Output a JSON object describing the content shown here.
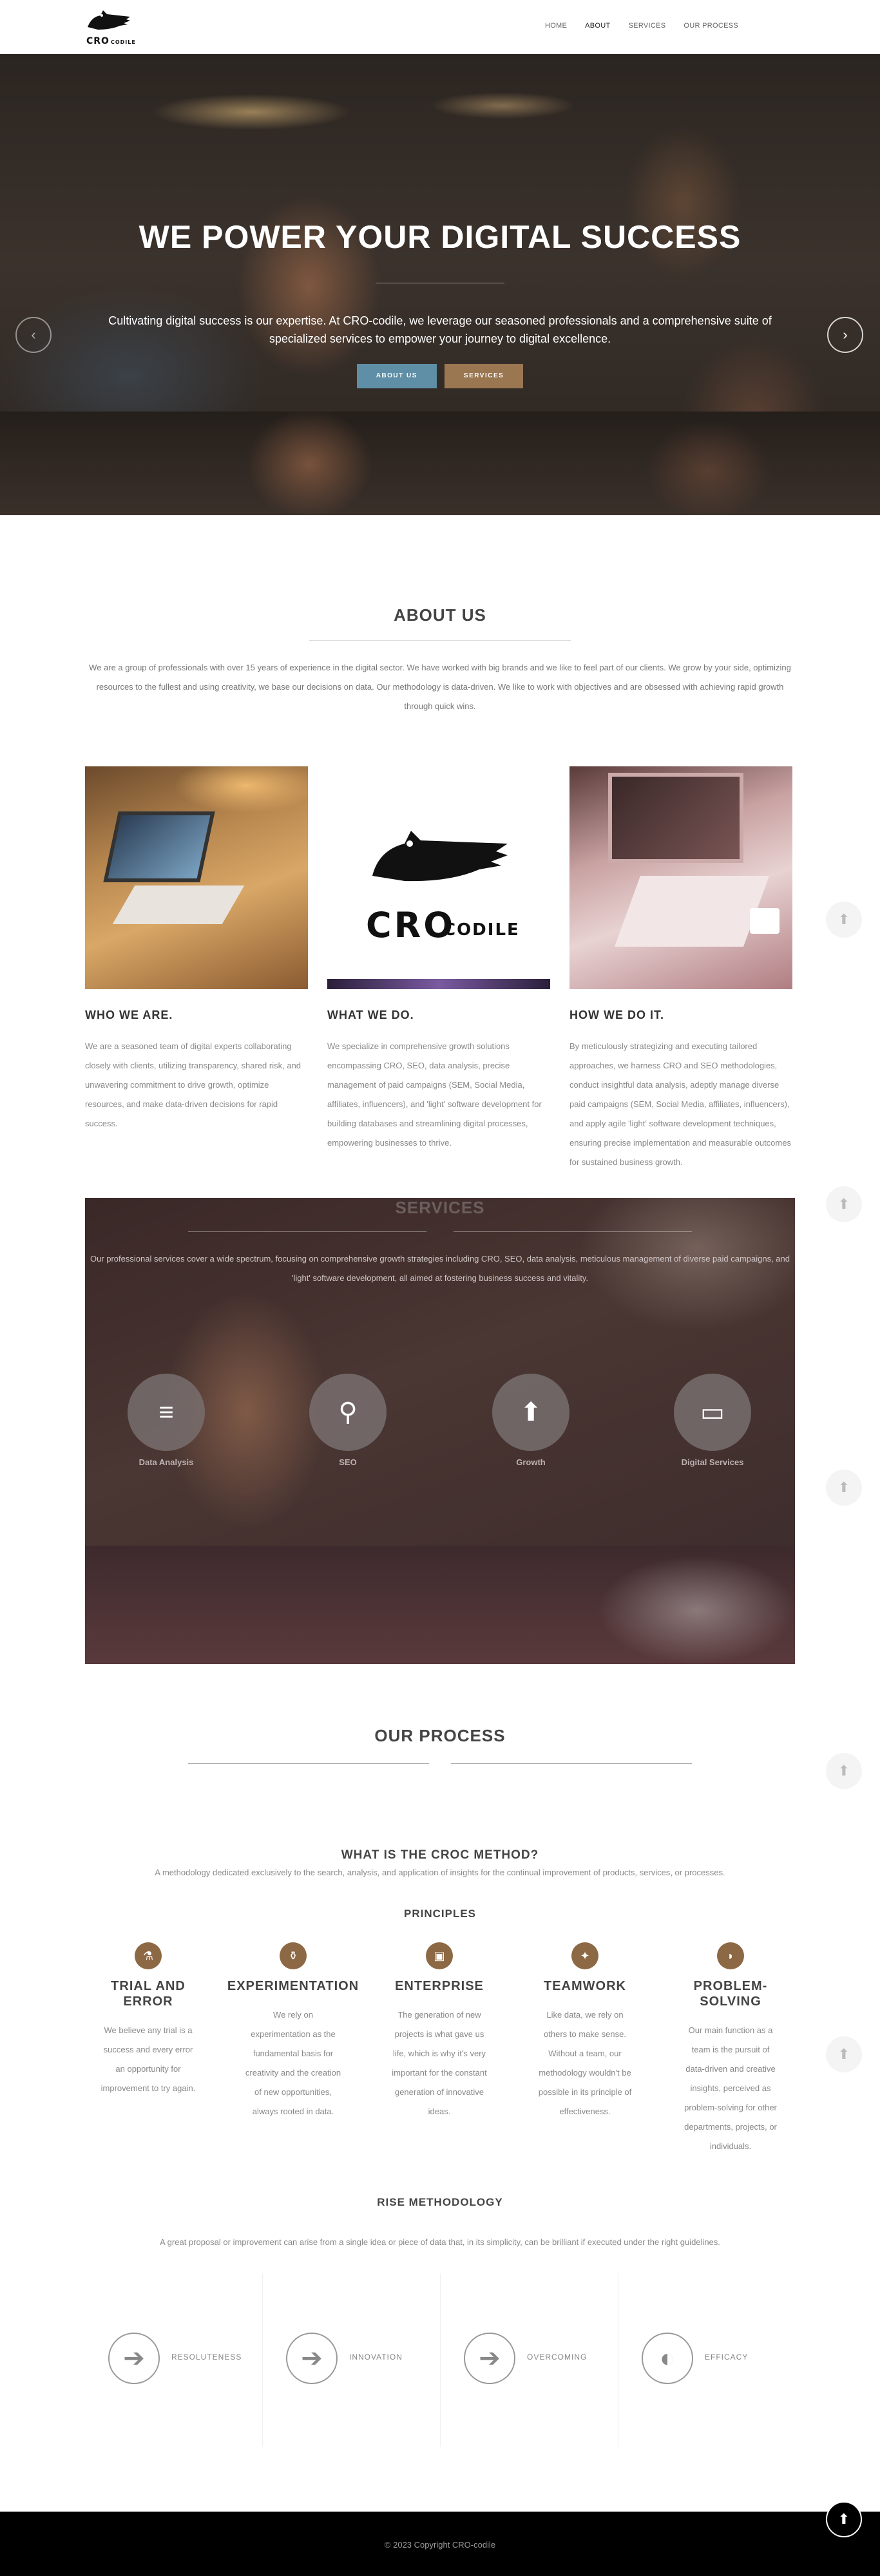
{
  "brand": {
    "name": "CRO",
    "suffix": "CODILE"
  },
  "nav": {
    "items": [
      "HOME",
      "ABOUT",
      "SERVICES",
      "OUR PROCESS"
    ],
    "active": "ABOUT"
  },
  "hero": {
    "title": "WE POWER YOUR DIGITAL SUCCESS",
    "text": "Cultivating digital success is our expertise. At CRO-codile, we leverage our seasoned professionals and a comprehensive suite of specialized services to empower your journey to digital excellence.",
    "buttons": [
      "ABOUT US",
      "SERVICES"
    ],
    "prev_icon": "chevron-left-icon",
    "next_icon": "chevron-right-icon"
  },
  "about": {
    "title": "ABOUT US",
    "text": "We are a group of professionals with over 15 years of experience in the digital sector. We have worked with big brands and we like to feel part of our clients. We grow by your side, optimizing resources to the fullest and using creativity, we base our decisions on data. Our methodology is data-driven. We like to work with objectives and are obsessed with achieving rapid growth through quick wins.",
    "cards": [
      {
        "title": "WHO WE ARE.",
        "text": "We are a seasoned team of digital experts collaborating closely with clients, utilizing transparency, shared risk, and unwavering commitment to drive growth, optimize resources, and make data-driven decisions for rapid success."
      },
      {
        "title": "WHAT WE DO.",
        "text": "We specialize in comprehensive growth solutions encompassing CRO, SEO, data analysis, precise management of paid campaigns (SEM, Social Media, affiliates, influencers), and 'light' software development for building databases and streamlining digital processes, empowering businesses to thrive."
      },
      {
        "title": "HOW WE DO IT.",
        "text": "By meticulously strategizing and executing tailored approaches, we harness CRO and SEO methodologies, conduct insightful data analysis, adeptly manage diverse paid campaigns (SEM, Social Media, affiliates, influencers), and apply agile 'light' software development techniques, ensuring precise implementation and measurable outcomes for sustained business growth."
      }
    ]
  },
  "services": {
    "title": "SERVICES",
    "text": "Our professional services cover a wide spectrum, focusing on comprehensive growth strategies including CRO, SEO, data analysis, meticulous management of diverse paid campaigns, and 'light' software development, all aimed at fostering business success and vitality.",
    "items": [
      {
        "label": "Data Analysis",
        "icon": "database-icon"
      },
      {
        "label": "SEO",
        "icon": "search-icon"
      },
      {
        "label": "Growth",
        "icon": "arrow-up-icon"
      },
      {
        "label": "Digital Services",
        "icon": "laptop-icon"
      }
    ]
  },
  "process": {
    "title": "OUR PROCESS",
    "croc_title": "WHAT IS THE CROC METHOD?",
    "croc_text": "A methodology dedicated exclusively to the search, analysis, and application of insights for the continual improvement of products, services, or processes.",
    "principles_title": "PRINCIPLES",
    "principles": [
      {
        "title": "TRIAL AND ERROR",
        "text": "We believe any trial is a success and every error an opportunity for improvement to try again.",
        "icon": "flask-icon"
      },
      {
        "title": "EXPERIMENTATION",
        "text": "We rely on experimentation as the fundamental basis for creativity and the creation of new opportunities, always rooted in data.",
        "icon": "beaker-icon"
      },
      {
        "title": "ENTERPRISE",
        "text": "The generation of new projects is what gave us life, which is why it's very important for the constant generation of innovative ideas.",
        "icon": "briefcase-icon"
      },
      {
        "title": "TEAMWORK",
        "text": "Like data, we rely on others to make sense. Without a team, our methodology wouldn't be possible in its principle of effectiveness.",
        "icon": "team-icon"
      },
      {
        "title": "PROBLEM-SOLVING",
        "text": "Our main function as a team is the pursuit of data-driven and creative insights, perceived as problem-solving for other departments, projects, or individuals.",
        "icon": "puzzle-icon"
      }
    ],
    "rise_title": "RISE METHODOLOGY",
    "rise_text": "A great proposal or improvement can arise from a single idea or piece of data that, in its simplicity, can be brilliant if executed under the right guidelines.",
    "rise_items": [
      {
        "label": "RESOLUTENESS",
        "icon": "arrow-right-icon"
      },
      {
        "label": "INNOVATION",
        "icon": "arrow-right-icon"
      },
      {
        "label": "OVERCOMING",
        "icon": "arrow-right-icon"
      },
      {
        "label": "EFFICACY",
        "icon": "half-circle-icon"
      }
    ]
  },
  "footer": {
    "copyright": "© 2023 Copyright CRO-codile"
  }
}
